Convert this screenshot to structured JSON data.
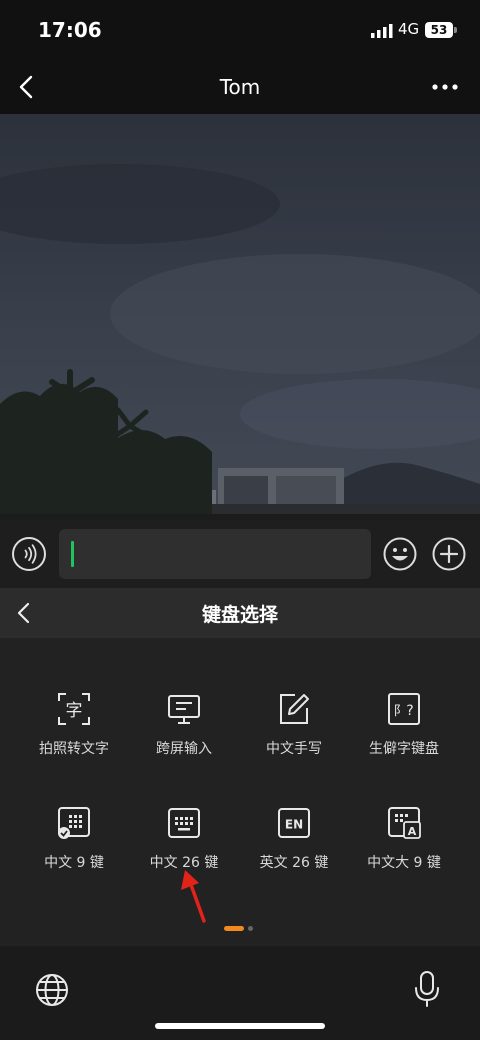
{
  "status": {
    "time": "17:06",
    "network": "4G",
    "battery": "53"
  },
  "header": {
    "title": "Tom"
  },
  "keyboard_panel": {
    "title": "键盘选择",
    "options": [
      {
        "label": "拍照转文字",
        "icon": "photo-to-text-icon"
      },
      {
        "label": "跨屏输入",
        "icon": "cross-screen-input-icon"
      },
      {
        "label": "中文手写",
        "icon": "handwriting-icon"
      },
      {
        "label": "生僻字键盘",
        "icon": "rare-character-icon"
      },
      {
        "label": "中文 9 键",
        "icon": "keypad-9-icon"
      },
      {
        "label": "中文 26 键",
        "icon": "keyboard-26-icon"
      },
      {
        "label": "英文 26 键",
        "icon": "en-keyboard-icon"
      },
      {
        "label": "中文大 9 键",
        "icon": "large-keypad-9-icon"
      }
    ]
  },
  "colors": {
    "caret": "#22c35e",
    "page_indicator": "#f28a1d",
    "annotation_arrow": "#e2231a"
  }
}
